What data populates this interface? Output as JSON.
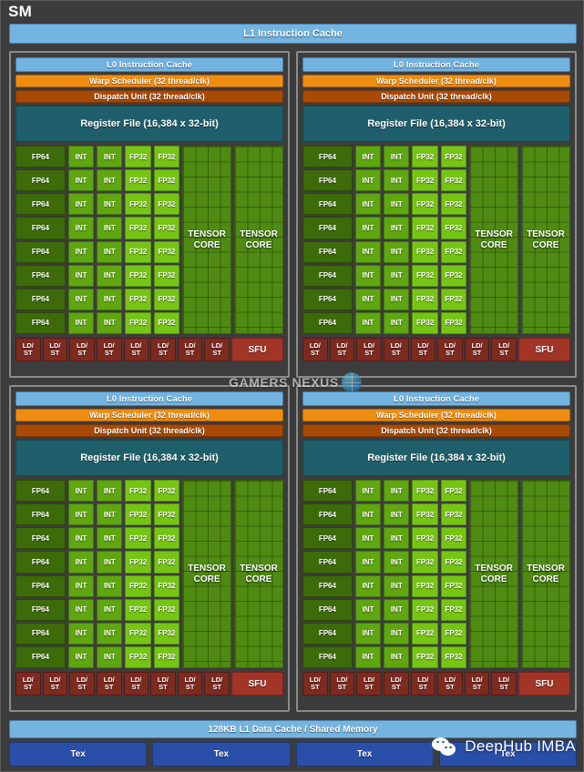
{
  "diagram": {
    "title": "SM",
    "l1_instruction_cache": "L1 Instruction Cache",
    "l1_data_cache": "128KB L1 Data Cache / Shared Memory"
  },
  "processing_block": {
    "l0_instruction_cache": "L0 Instruction Cache",
    "warp_scheduler": "Warp Scheduler (32 thread/clk)",
    "dispatch_unit": "Dispatch Unit (32 thread/clk)",
    "register_file": "Register File (16,384 x 32-bit)",
    "fp64_label": "FP64",
    "int_label": "INT",
    "fp32_label": "FP32",
    "tensor_core_line1": "TENSOR",
    "tensor_core_line2": "CORE",
    "ldst_line1": "LD/",
    "ldst_line2": "ST",
    "sfu_label": "SFU",
    "counts": {
      "core_rows": 8,
      "fp64_columns": 1,
      "int_columns": 2,
      "fp32_columns": 2,
      "tensor_cores": 2,
      "ldst_units": 8,
      "sfu_units": 1
    }
  },
  "tex_units": [
    {
      "label": "Tex"
    },
    {
      "label": "Tex"
    },
    {
      "label": "Tex"
    },
    {
      "label": "Tex"
    }
  ],
  "quadrants": [
    {
      "id": "processing-block-0"
    },
    {
      "id": "processing-block-1"
    },
    {
      "id": "processing-block-2"
    },
    {
      "id": "processing-block-3"
    }
  ],
  "watermarks": {
    "gamers_nexus": "GAMERS NEXUS",
    "deephub": "DeepHub IMBA"
  },
  "colors": {
    "background": "#3c3c3c",
    "instruction_cache": "#72b3e0",
    "warp_scheduler": "#ef8d11",
    "dispatch_unit": "#a84a06",
    "register_file": "#1f5f6b",
    "fp64": "#3d6b0a",
    "int": "#5fa610",
    "fp32": "#76c514",
    "tensor_core": "#4f8b12",
    "ldst": "#7d2a20",
    "sfu": "#a33527",
    "l1_data_cache": "#75b4e0",
    "tex": "#2a4fa8"
  }
}
